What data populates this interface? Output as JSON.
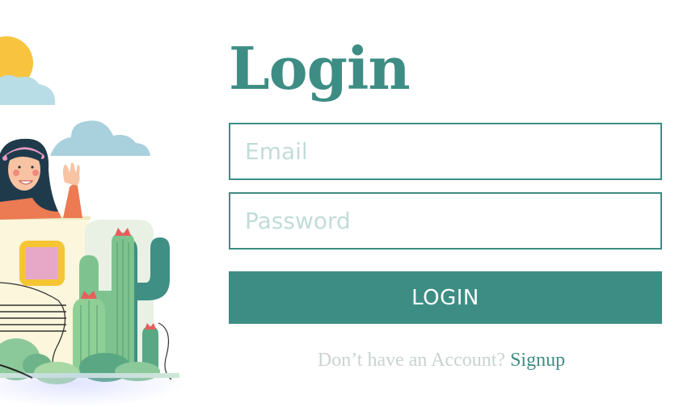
{
  "login": {
    "title": "Login",
    "email_placeholder": "Email",
    "password_placeholder": "Password",
    "submit_label": "LOGIN",
    "signup_prompt": "Don’t have an Account?",
    "signup_link": "Signup"
  },
  "colors": {
    "accent": "#3d8d84",
    "placeholder": "#c2dcd8",
    "muted_text": "#c9d3d1"
  },
  "illustration": {
    "icons": [
      "sun-icon",
      "cloud-icon",
      "woman-waving-icon",
      "cactus-icon",
      "house-icon"
    ]
  }
}
